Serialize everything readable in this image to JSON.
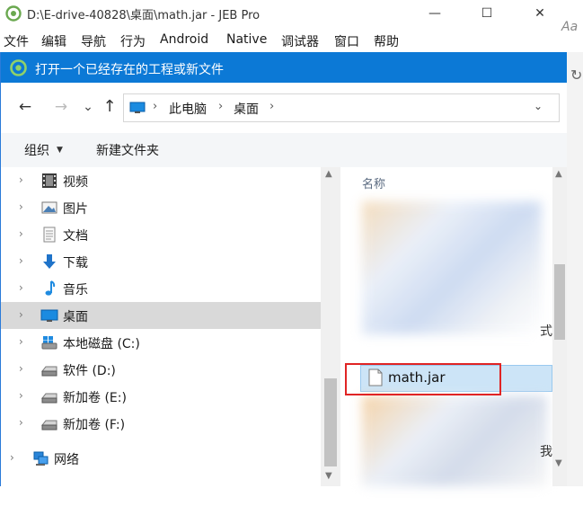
{
  "jeb": {
    "title": "D:\\E-drive-40828\\桌面\\math.jar - JEB Pro",
    "min_glyph": "—",
    "max_glyph": "☐",
    "close_glyph": "✕",
    "menus": [
      "文件",
      "编辑",
      "导航",
      "行为",
      "Android",
      "Native",
      "调试器",
      "窗口",
      "帮助"
    ],
    "right_fragment": "Aa"
  },
  "dialog": {
    "title": "打开一个已经存在的工程或新文件",
    "nav": {
      "back_glyph": "←",
      "forward_glyph": "→",
      "recent_glyph": "⌄",
      "up_glyph": "↑",
      "separator_glyph": "›",
      "breadcrumbs": [
        "此电脑",
        "桌面"
      ],
      "dropdown_glyph": "⌄",
      "refresh_glyph": "↻"
    },
    "toolbar": {
      "organize": "组织",
      "organize_arrow": "▼",
      "new_folder": "新建文件夹"
    },
    "tree": {
      "items": [
        {
          "label": "视频",
          "icon": "video-icon"
        },
        {
          "label": "图片",
          "icon": "picture-icon"
        },
        {
          "label": "文档",
          "icon": "document-icon"
        },
        {
          "label": "下载",
          "icon": "download-icon"
        },
        {
          "label": "音乐",
          "icon": "music-icon"
        },
        {
          "label": "桌面",
          "icon": "desktop-icon",
          "selected": true
        },
        {
          "label": "本地磁盘 (C:)",
          "icon": "windows-drive-icon"
        },
        {
          "label": "软件 (D:)",
          "icon": "drive-icon"
        },
        {
          "label": "新加卷 (E:)",
          "icon": "drive-icon"
        },
        {
          "label": "新加卷 (F:)",
          "icon": "drive-icon"
        },
        {
          "label": "网络",
          "icon": "network-icon"
        }
      ],
      "chevron_glyph": "›",
      "scroll_up_glyph": "▲",
      "scroll_down_glyph": "▼"
    },
    "files": {
      "column_name": "名称",
      "file_name": "math.jar",
      "fragment_top": "式",
      "fragment_bottom": "我",
      "scroll_up_glyph": "▲",
      "scroll_down_glyph": "▼"
    }
  }
}
